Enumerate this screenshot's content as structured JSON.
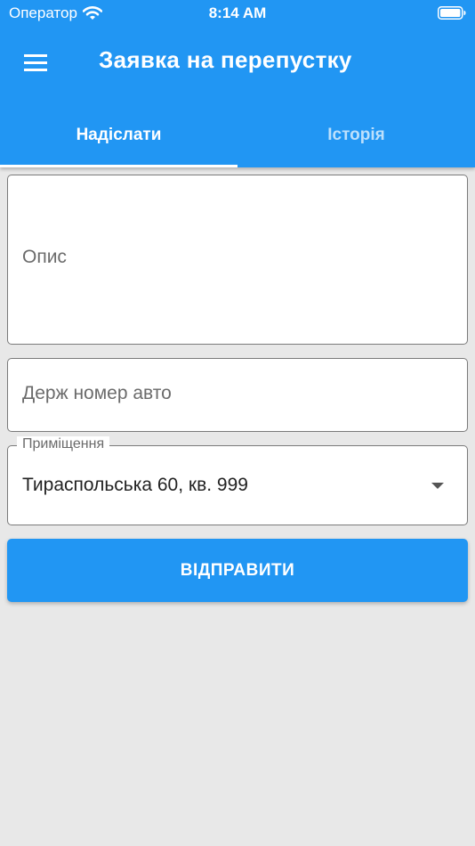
{
  "status_bar": {
    "carrier": "Оператор",
    "time": "8:14 AM",
    "icons": [
      "wifi-icon",
      "battery-icon"
    ]
  },
  "app_bar": {
    "title": "Заявка на перепустку",
    "menu_icon": "menu-icon"
  },
  "tabs": [
    {
      "label": "Надіслати",
      "active": true
    },
    {
      "label": "Історія",
      "active": false
    }
  ],
  "form": {
    "description": {
      "placeholder": "Опис",
      "value": ""
    },
    "plate": {
      "placeholder": "Держ номер авто",
      "value": ""
    },
    "premises": {
      "label": "Приміщення",
      "value": "Тираспольська 60, кв. 999",
      "icon": "dropdown-arrow-icon"
    },
    "submit_label": "ВІДПРАВИТИ"
  },
  "colors": {
    "primary": "#2196f3",
    "background": "#e8e8e8",
    "border": "#7a7a7a"
  }
}
